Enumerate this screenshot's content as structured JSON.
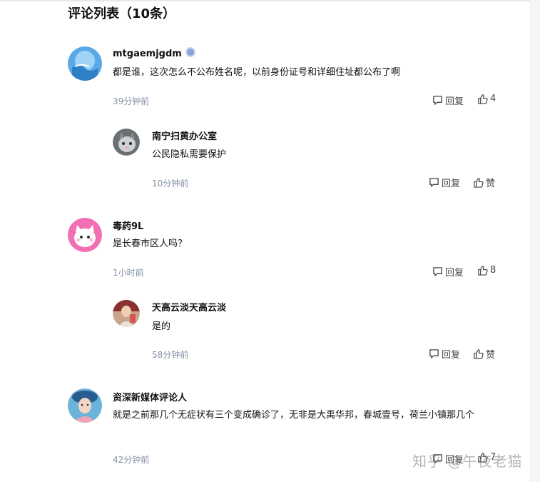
{
  "section": {
    "title": "评论列表（10条）"
  },
  "comments": [
    {
      "user": "mtgaemjgdm",
      "text": "都是谁，这次怎么不公布姓名呢，以前身份证号和详细住址都公布了啊",
      "time": "39分钟前",
      "reply_label": "回复",
      "like_label": "4",
      "reply": {
        "user": "南宁扫黄办公室",
        "text": "公民隐私需要保护",
        "time": "10分钟前",
        "reply_label": "回复",
        "like_label": "赞"
      }
    },
    {
      "user": "毒药9L",
      "text": "是长春市区人吗？",
      "time": "1小时前",
      "reply_label": "回复",
      "like_label": "8",
      "reply": {
        "user": "天高云淡天高云淡",
        "text": "是的",
        "time": "58分钟前",
        "reply_label": "回复",
        "like_label": "赞"
      }
    },
    {
      "user": "资深新媒体评论人",
      "text": "就是之前那几个无症状有三个变成确诊了，无非是大禹华邦，春城壹号，荷兰小镇那几个",
      "time": "42分钟前",
      "reply_label": "回复",
      "like_label": "7"
    }
  ],
  "watermark": "知乎 @午夜老猫"
}
